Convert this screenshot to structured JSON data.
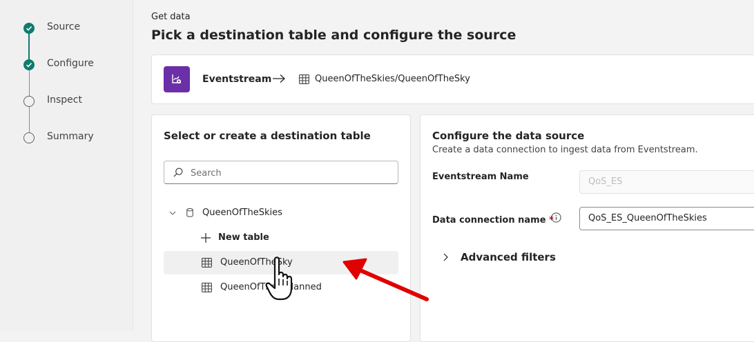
{
  "steps": [
    {
      "label": "Source",
      "status": "done"
    },
    {
      "label": "Configure",
      "status": "done"
    },
    {
      "label": "Inspect",
      "status": "todo"
    },
    {
      "label": "Summary",
      "status": "todo"
    }
  ],
  "header": {
    "kicker": "Get data",
    "title": "Pick a destination table and configure the source"
  },
  "route": {
    "source_name": "Eventstream",
    "destination": "QueenOfTheSkies/QueenOfTheSky"
  },
  "left_panel": {
    "title": "Select or create a destination table",
    "search_placeholder": "Search",
    "database": "QueenOfTheSkies",
    "new_table_label": "New table",
    "tables": [
      "QueenOfTheSky",
      "QueenOfThe…Planned"
    ]
  },
  "right_panel": {
    "title": "Configure the data source",
    "subtitle": "Create a data connection to ingest data from Eventstream.",
    "eventstream_name_label": "Eventstream Name",
    "eventstream_name_value": "QoS_ES",
    "connection_name_label": "Data connection name",
    "connection_name_value": "QoS_ES_QueenOfTheSkies",
    "advanced_filters_label": "Advanced filters"
  },
  "colors": {
    "step_done": "#0f7b6c",
    "eventstream_tile": "#6b2fa8",
    "annotation_arrow": "#e00000"
  }
}
